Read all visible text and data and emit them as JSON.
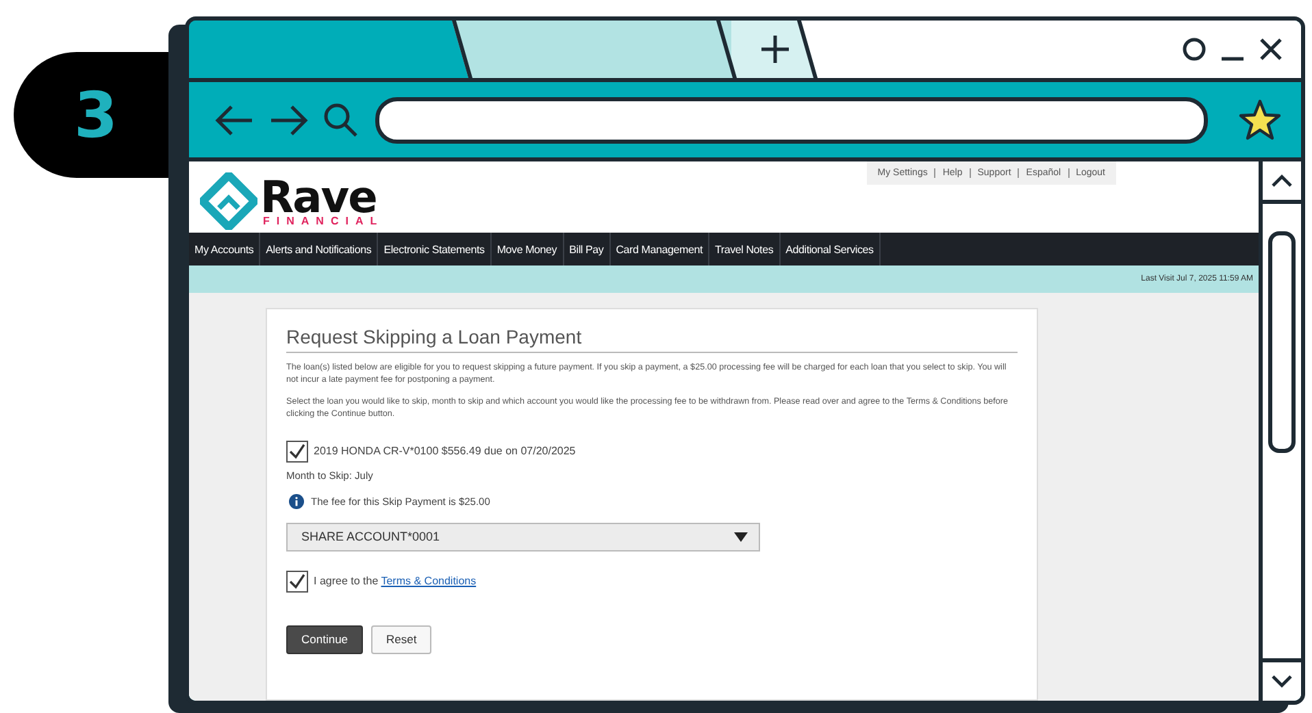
{
  "step": "3",
  "site": {
    "logo": {
      "name": "Rave",
      "sub": "FINANCIAL"
    },
    "top_links": [
      "My Settings",
      "Help",
      "Support",
      "Español",
      "Logout"
    ],
    "nav": [
      "My Accounts",
      "Alerts and Notifications",
      "Electronic Statements",
      "Move Money",
      "Bill Pay",
      "Card Management",
      "Travel Notes",
      "Additional Services"
    ],
    "last_visit": "Last Visit Jul 7, 2025 11:59 AM"
  },
  "card": {
    "title": "Request Skipping a Loan Payment",
    "paragraphs": [
      "The loan(s) listed below are eligible for you to request skipping a future payment. If you skip a payment, a $25.00 processing fee will be charged for each loan that you select to skip. You will not incur a late payment fee for postponing a payment.",
      "Select the loan you would like to skip, month to skip and which account you would like the processing fee to be withdrawn from. Please read over and agree to the Terms & Conditions before clicking the Continue button."
    ],
    "loans": [
      {
        "label": "2019 HONDA CR-V*0100 $556.49 due on 07/20/2025",
        "checked": true
      }
    ],
    "month_to_skip": "Month to Skip: July",
    "fee_note": "The fee for this Skip Payment is $25.00",
    "account_select": {
      "value": "SHARE ACCOUNT*0001"
    },
    "agree": {
      "text": "I agree to the",
      "link": "Terms & Conditions",
      "checked": true
    },
    "buttons": [
      {
        "label": "Continue",
        "kind": "primary"
      },
      {
        "label": "Reset",
        "kind": "secondary"
      }
    ]
  }
}
